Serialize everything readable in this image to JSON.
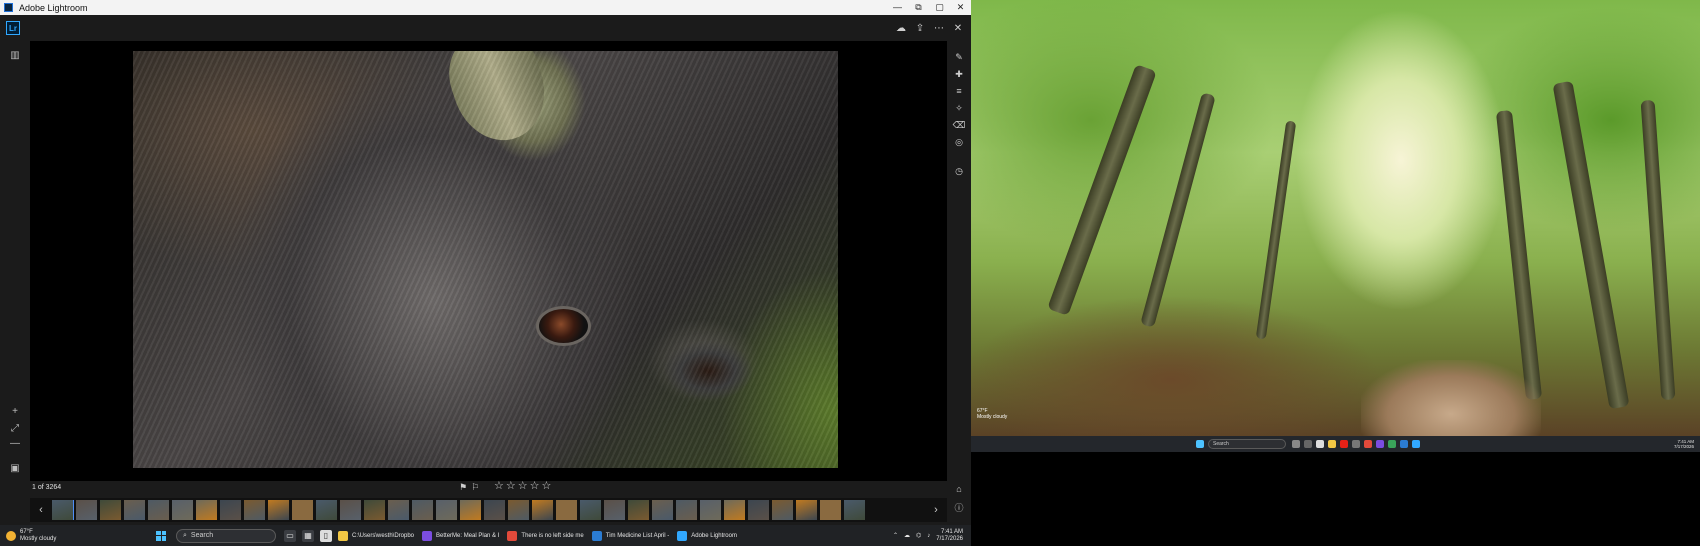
{
  "window": {
    "title": "Adobe Lightroom",
    "controls": [
      "—",
      "▢",
      "✕"
    ],
    "restore": "⧉"
  },
  "lr": {
    "logo": "Lr",
    "header_icons": [
      "cloud-icon",
      "share-icon",
      "more-icon",
      "close-icon"
    ],
    "photo_count": "1 of 3264",
    "rating_stars": 0,
    "left_rail_icons": [
      "panel-toggle-icon",
      "zoom-in-icon",
      "fit-icon",
      "zoom-out-icon",
      "filmstrip-icon"
    ],
    "right_rail_icons": [
      "edit-icon",
      "heal-icon",
      "adjust-icon",
      "presets-icon",
      "eraser-icon",
      "mask-icon",
      "history-icon",
      "tag-icon",
      "info-icon"
    ]
  },
  "taskbar_left": {
    "weather_temp": "67°F",
    "weather_desc": "Mostly cloudy",
    "search_placeholder": "Search",
    "tasks": [
      {
        "label": "C:\\Users\\westh\\Dropbo",
        "color": "#f2c744"
      },
      {
        "label": "BetterMe: Meal Plan & I",
        "color": "#7b4de0"
      },
      {
        "label": "There is no left side me",
        "color": "#e24a3b"
      },
      {
        "label": "Tim Medicine List April -",
        "color": "#2b7cd3"
      },
      {
        "label": "Adobe Lightroom",
        "color": "#31a8ff"
      }
    ],
    "time": "7:41 AM",
    "date": "7/17/2026"
  },
  "taskbar_right": {
    "weather_temp": "67°F",
    "weather_desc": "Mostly cloudy",
    "search_placeholder": "Search",
    "time": "7:41 AM",
    "date": "7/17/2026"
  },
  "colors": {
    "accent": "#31a8ff",
    "filmstrip_selected": "#4f8ef7"
  }
}
